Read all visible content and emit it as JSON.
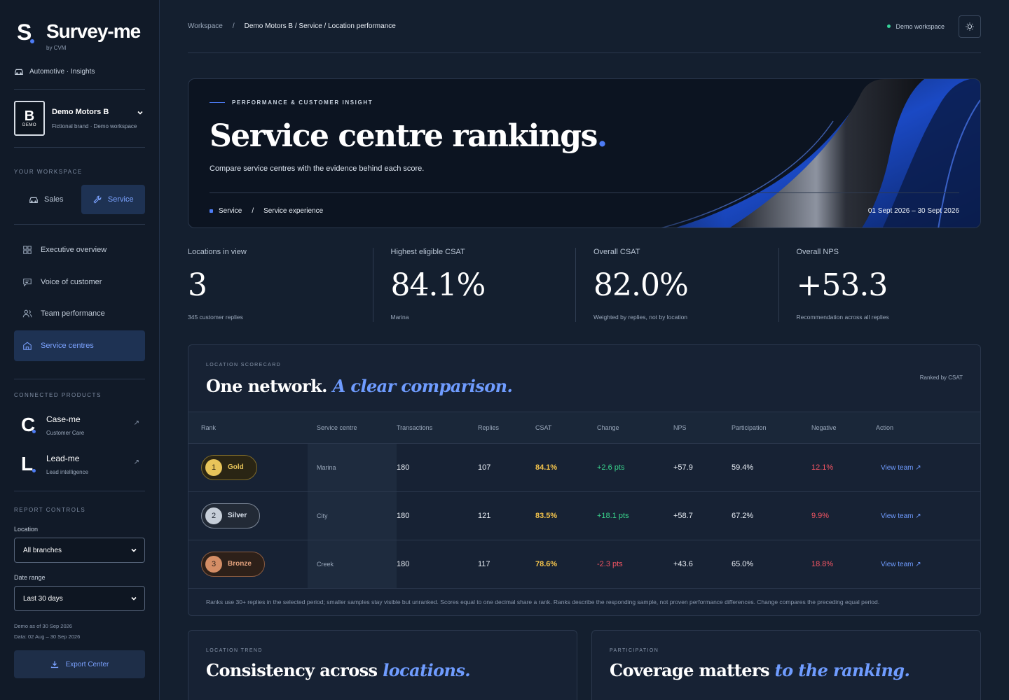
{
  "brand": {
    "name": "Survey-me",
    "sub": "by CVM",
    "glyph": "S"
  },
  "sector": "Automotive · Insights",
  "org": {
    "logo_letter": "B",
    "logo_tag": "DEMO",
    "name": "Demo Motors B",
    "sub": "Fictional brand · Demo workspace"
  },
  "workspace": {
    "label": "YOUR WORKSPACE",
    "tabs": [
      {
        "label": "Sales"
      },
      {
        "label": "Service"
      }
    ]
  },
  "nav": [
    {
      "label": "Executive overview",
      "icon": "grid-icon"
    },
    {
      "label": "Voice of customer",
      "icon": "chat-icon"
    },
    {
      "label": "Team performance",
      "icon": "users-icon"
    },
    {
      "label": "Service centres",
      "icon": "building-icon"
    }
  ],
  "connected": {
    "label": "CONNECTED PRODUCTS",
    "items": [
      {
        "glyph": "C",
        "name": "Case-me",
        "sub": "Customer Care"
      },
      {
        "glyph": "L",
        "name": "Lead-me",
        "sub": "Lead intelligence"
      }
    ]
  },
  "controls": {
    "label": "REPORT CONTROLS",
    "location_label": "Location",
    "location_value": "All branches",
    "date_label": "Date range",
    "date_value": "Last 30 days",
    "demo_note_1": "Demo as of 30 Sep 2026",
    "demo_note_2": "Data: 02 Aug – 30 Sep 2026",
    "export_label": "Export Center"
  },
  "breadcrumb": {
    "root": "Workspace",
    "sep": "/",
    "current": "Demo Motors B / Service / Location performance"
  },
  "workspace_status": "Demo workspace",
  "hero": {
    "kicker": "PERFORMANCE & CUSTOMER INSIGHT",
    "title": "Service centre rankings",
    "title_dot": ".",
    "desc": "Compare service centres with the evidence behind each score.",
    "tag1": "Service",
    "tag_sep": "/",
    "tag2": "Service experience",
    "date": "01 Sept 2026 – 30 Sept 2026"
  },
  "kpis": [
    {
      "label": "Locations in view",
      "value": "3",
      "sub": "345 customer replies"
    },
    {
      "label": "Highest eligible CSAT",
      "value": "84.1%",
      "sub": "Marina"
    },
    {
      "label": "Overall CSAT",
      "value": "82.0%",
      "sub": "Weighted by replies, not by location"
    },
    {
      "label": "Overall NPS",
      "value": "+53.3",
      "sub": "Recommendation across all replies"
    }
  ],
  "scorecard": {
    "kicker": "LOCATION SCORECARD",
    "title_a": "One network.",
    "title_b": "A clear comparison.",
    "ranked_by": "Ranked by CSAT",
    "columns": [
      "Rank",
      "Service centre",
      "Transactions",
      "Replies",
      "CSAT",
      "Change",
      "NPS",
      "Participation",
      "Negative",
      "Action"
    ],
    "rows": [
      {
        "rank": "1",
        "tier": "Gold",
        "centre": "Marina",
        "transactions": "180",
        "replies": "107",
        "csat": "84.1%",
        "change": "+2.6 pts",
        "nps": "+57.9",
        "participation": "59.4%",
        "negative": "12.1%",
        "action": "View team ↗"
      },
      {
        "rank": "2",
        "tier": "Silver",
        "centre": "City",
        "transactions": "180",
        "replies": "121",
        "csat": "83.5%",
        "change": "+18.1 pts",
        "nps": "+58.7",
        "participation": "67.2%",
        "negative": "9.9%",
        "action": "View team ↗"
      },
      {
        "rank": "3",
        "tier": "Bronze",
        "centre": "Creek",
        "transactions": "180",
        "replies": "117",
        "csat": "78.6%",
        "change": "-2.3 pts",
        "nps": "+43.6",
        "participation": "65.0%",
        "negative": "18.8%",
        "action": "View team ↗"
      }
    ],
    "footnote": "Ranks use 30+ replies in the selected period; smaller samples stay visible but unranked. Scores equal to one decimal share a rank. Ranks describe the responding sample, not proven performance differences. Change compares the preceding equal period."
  },
  "trend": {
    "kicker": "LOCATION TREND",
    "title_a": "Consistency across",
    "title_b": "locations."
  },
  "participation": {
    "kicker": "PARTICIPATION",
    "title_a": "Coverage matters",
    "title_b": "to the ranking."
  },
  "colors": {
    "accent": "#4d7cf6",
    "gold": "#e8c55a",
    "positive": "#39d48c",
    "negative": "#f25563"
  }
}
